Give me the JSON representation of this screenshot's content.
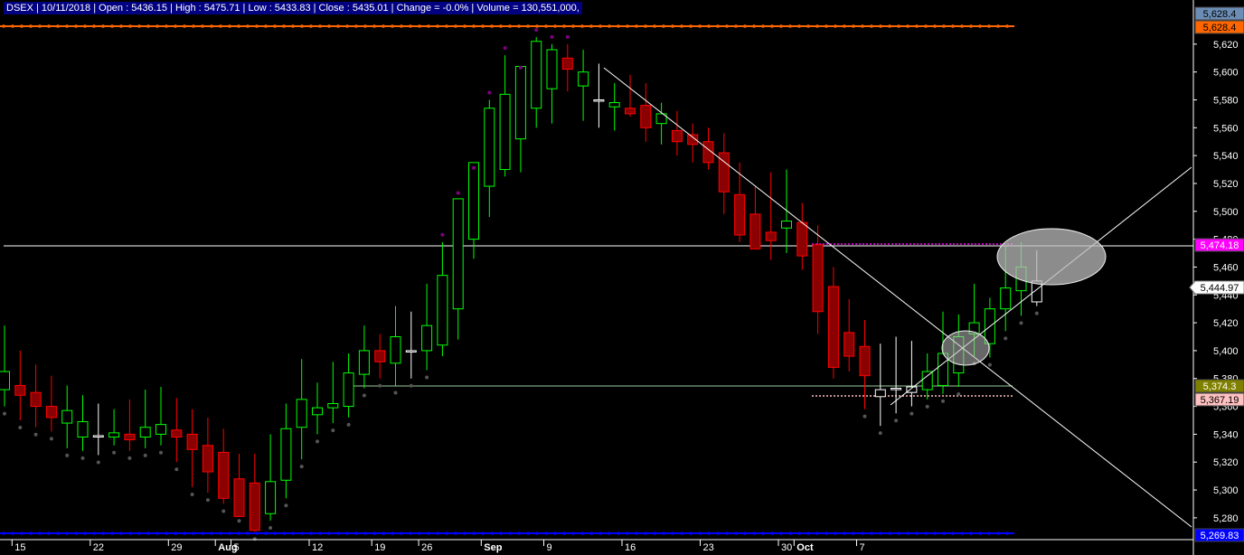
{
  "header": {
    "text": "DSEX | 10/11/2018 | Open : 5436.15 | High : 5475.71 | Low : 5433.83 | Close : 5435.01 | Change = -0.0% | Volume = 130,551,000,"
  },
  "colors": {
    "background": "#000000",
    "up": "#00ff00",
    "down": "#ff0000",
    "neutral": "#ffffff",
    "resistance_line": "#ff6600",
    "support_line": "#0000ff",
    "highlight_magenta": "#ff00ff",
    "highlight_olive": "#808000",
    "highlight_pink": "#ffc0c0"
  },
  "chart_data": {
    "type": "candlestick",
    "ylim": [
      5265,
      5640
    ],
    "y_ticks": [
      5280,
      5300,
      5320,
      5340,
      5360,
      5380,
      5400,
      5420,
      5440,
      5460,
      5480,
      5500,
      5520,
      5540,
      5560,
      5580,
      5600,
      5620
    ],
    "y_tick_labels": [
      "5,280",
      "5,300",
      "5,320",
      "5,340",
      "5,360",
      "5,380",
      "5,400",
      "5,420",
      "5,440",
      "5,460",
      "5,480",
      "5,500",
      "5,520",
      "5,540",
      "5,560",
      "5,580",
      "5,600",
      "5,620"
    ],
    "x_labels": [
      "15",
      "22",
      "29",
      "Aug",
      "5",
      "12",
      "19",
      "26",
      "Sep",
      "9",
      "16",
      "23",
      "30",
      "Oct",
      "7"
    ],
    "x_label_bar_index": [
      1,
      6,
      11,
      14,
      15,
      20,
      24,
      27,
      31,
      35,
      40,
      45,
      50,
      51,
      55
    ],
    "candles": [
      [
        5372,
        5418,
        5360,
        5385
      ],
      [
        5375,
        5400,
        5350,
        5368
      ],
      [
        5370,
        5390,
        5345,
        5360
      ],
      [
        5360,
        5382,
        5342,
        5352
      ],
      [
        5348,
        5375,
        5330,
        5357
      ],
      [
        5338,
        5368,
        5328,
        5349
      ],
      [
        5338,
        5362,
        5325,
        5339
      ],
      [
        5338,
        5358,
        5332,
        5341
      ],
      [
        5340,
        5365,
        5328,
        5336
      ],
      [
        5338,
        5372,
        5330,
        5345
      ],
      [
        5340,
        5374,
        5332,
        5347
      ],
      [
        5343,
        5366,
        5320,
        5338
      ],
      [
        5340,
        5358,
        5302,
        5329
      ],
      [
        5332,
        5352,
        5298,
        5313
      ],
      [
        5327,
        5344,
        5290,
        5294
      ],
      [
        5308,
        5326,
        5283,
        5281
      ],
      [
        5305,
        5326,
        5270,
        5271
      ],
      [
        5283,
        5340,
        5278,
        5306
      ],
      [
        5307,
        5362,
        5294,
        5344
      ],
      [
        5345,
        5394,
        5322,
        5365
      ],
      [
        5354,
        5377,
        5340,
        5359
      ],
      [
        5359,
        5392,
        5348,
        5362
      ],
      [
        5360,
        5398,
        5352,
        5384
      ],
      [
        5383,
        5418,
        5373,
        5400
      ],
      [
        5400,
        5412,
        5380,
        5392
      ],
      [
        5391,
        5432,
        5375,
        5410
      ],
      [
        5400,
        5428,
        5380,
        5400
      ],
      [
        5400,
        5448,
        5386,
        5418
      ],
      [
        5404,
        5478,
        5396,
        5454
      ],
      [
        5430,
        5508,
        5408,
        5509
      ],
      [
        5480,
        5526,
        5466,
        5535
      ],
      [
        5518,
        5580,
        5496,
        5574
      ],
      [
        5530,
        5612,
        5525,
        5584
      ],
      [
        5552,
        5598,
        5528,
        5604
      ],
      [
        5574,
        5625,
        5560,
        5622
      ],
      [
        5588,
        5620,
        5563,
        5616
      ],
      [
        5610,
        5620,
        5586,
        5602
      ],
      [
        5590,
        5616,
        5565,
        5600
      ],
      [
        5580,
        5606,
        5560,
        5580
      ],
      [
        5575,
        5592,
        5558,
        5578
      ],
      [
        5574,
        5598,
        5568,
        5570
      ],
      [
        5576,
        5592,
        5550,
        5560
      ],
      [
        5563,
        5578,
        5548,
        5570
      ],
      [
        5558,
        5572,
        5540,
        5550
      ],
      [
        5555,
        5563,
        5535,
        5548
      ],
      [
        5550,
        5560,
        5530,
        5535
      ],
      [
        5542,
        5556,
        5498,
        5514
      ],
      [
        5512,
        5535,
        5478,
        5483
      ],
      [
        5498,
        5518,
        5475,
        5473
      ],
      [
        5485,
        5528,
        5465,
        5479
      ],
      [
        5488,
        5530,
        5470,
        5493
      ],
      [
        5492,
        5506,
        5458,
        5468
      ],
      [
        5476,
        5490,
        5412,
        5428
      ],
      [
        5446,
        5460,
        5380,
        5388
      ],
      [
        5413,
        5437,
        5385,
        5396
      ],
      [
        5403,
        5422,
        5358,
        5382
      ],
      [
        5372,
        5405,
        5346,
        5367
      ],
      [
        5373,
        5410,
        5355,
        5372
      ],
      [
        5374,
        5407,
        5360,
        5370
      ],
      [
        5372,
        5398,
        5365,
        5385
      ],
      [
        5375,
        5428,
        5369,
        5398
      ],
      [
        5384,
        5426,
        5374,
        5410
      ],
      [
        5412,
        5448,
        5396,
        5420
      ],
      [
        5405,
        5438,
        5395,
        5430
      ],
      [
        5430,
        5475,
        5414,
        5445
      ],
      [
        5443,
        5478,
        5425,
        5460
      ],
      [
        5450,
        5472,
        5432,
        5435
      ]
    ]
  },
  "price_labels": {
    "top1": "5,628.4",
    "top2": "5,628.4",
    "magenta": "5,474.18",
    "current": "5,444.97",
    "olive": "5,374.3",
    "pink": "5,367.19",
    "bottom": "5,269.83"
  }
}
